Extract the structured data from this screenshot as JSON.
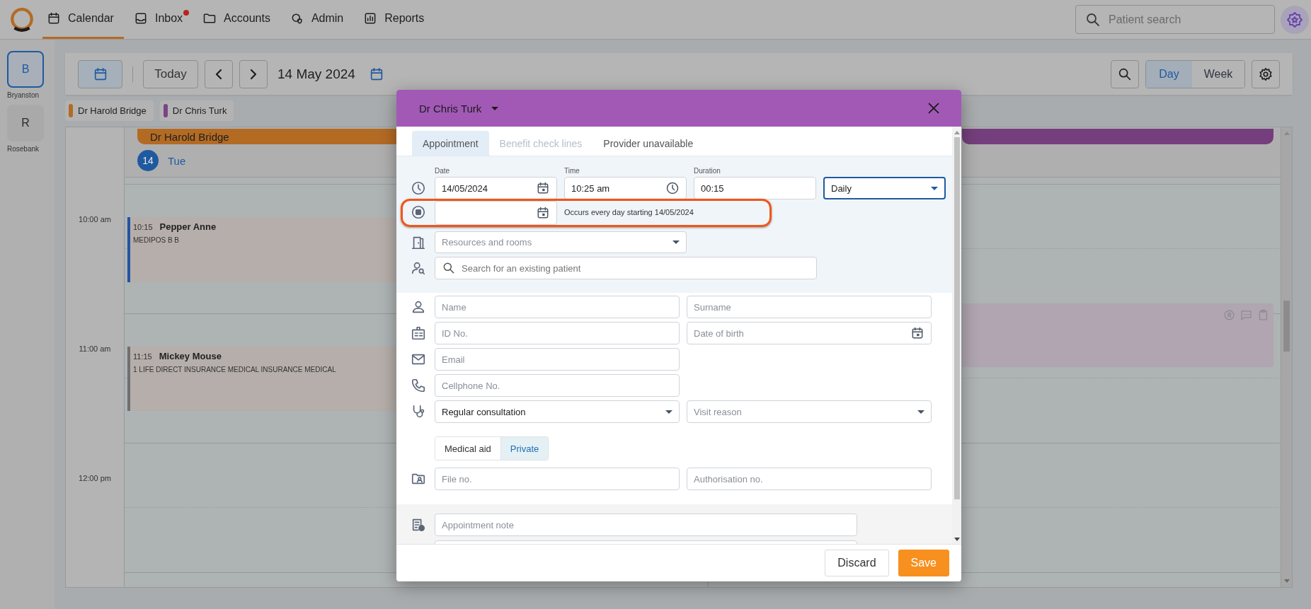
{
  "nav": {
    "items": [
      {
        "label": "Calendar",
        "selected": true,
        "unread": false
      },
      {
        "label": "Inbox",
        "selected": false,
        "unread": true
      },
      {
        "label": "Accounts",
        "selected": false,
        "unread": false
      },
      {
        "label": "Admin",
        "selected": false,
        "unread": false
      },
      {
        "label": "Reports",
        "selected": false,
        "unread": false
      }
    ],
    "search": {
      "placeholder": "Patient search"
    }
  },
  "locations": [
    {
      "initial": "B",
      "label": "Bryanston",
      "selected": true
    },
    {
      "initial": "R",
      "label": "Rosebank",
      "selected": false
    }
  ],
  "toolbar": {
    "today": "Today",
    "date": "14 May 2024",
    "views": [
      {
        "label": "Day",
        "selected": true
      },
      {
        "label": "Week",
        "selected": false
      }
    ]
  },
  "providers": [
    {
      "name": "Dr Harold Bridge",
      "color": "#b36b24"
    },
    {
      "name": "Dr Chris Turk",
      "color": "#7a4585"
    }
  ],
  "calendar": {
    "times": [
      "10:00 am",
      "11:00 am",
      "12:00 pm"
    ],
    "columns": [
      {
        "provider": "Dr Harold Bridge",
        "color": "#b36b24",
        "day_number": "14",
        "day_name": "Tue",
        "appointments": [
          {
            "time": "10:15",
            "patient": "Pepper Anne",
            "detail": "MEDIPOS B B",
            "color": "#2453a0"
          },
          {
            "time": "11:15",
            "patient": "Mickey Mouse",
            "detail": "1 LIFE DIRECT INSURANCE MEDICAL INSURANCE MEDICAL",
            "color": "#6f6f6f"
          }
        ]
      },
      {
        "color": "#743f7c",
        "appointments": [
          {
            "color": "#b0a5b0"
          }
        ]
      }
    ]
  },
  "modal": {
    "provider": "Dr Chris Turk",
    "tabs": [
      {
        "label": "Appointment",
        "selected": true,
        "disabled": false
      },
      {
        "label": "Benefit check lines",
        "selected": false,
        "disabled": true
      },
      {
        "label": "Provider unavailable",
        "selected": false,
        "disabled": false
      }
    ],
    "schedule": [
      {
        "kind": "date",
        "label": "Date",
        "value": "14/05/2024"
      },
      {
        "kind": "time",
        "label": "Time",
        "value": "10:25 am"
      },
      {
        "kind": "text",
        "label": "Duration",
        "value": "00:15"
      },
      {
        "kind": "select",
        "value": "Daily",
        "focused": true
      }
    ],
    "recurrence": {
      "summary": "Occurs every day starting 14/05/2024",
      "highlighted": true
    },
    "resources": {
      "placeholder": "Resources and rooms"
    },
    "patient_search": {
      "placeholder": "Search for an existing patient"
    },
    "patient_rows": [
      {
        "kind": "fields",
        "fields": [
          {
            "kind": "text",
            "placeholder": "Name"
          },
          {
            "kind": "text",
            "placeholder": "Surname"
          }
        ]
      },
      {
        "kind": "fields",
        "fields": [
          {
            "kind": "text",
            "placeholder": "ID No."
          },
          {
            "kind": "date",
            "placeholder": "Date of birth"
          }
        ]
      },
      {
        "kind": "fields",
        "fields": [
          {
            "kind": "text",
            "placeholder": "Email"
          }
        ]
      },
      {
        "kind": "fields",
        "fields": [
          {
            "kind": "text",
            "placeholder": "Cellphone No."
          }
        ]
      },
      {
        "kind": "fields",
        "fields": [
          {
            "kind": "select",
            "value": "Regular consultation"
          },
          {
            "kind": "select",
            "placeholder": "Visit reason"
          }
        ]
      },
      {
        "kind": "segmented",
        "options": [
          {
            "label": "Medical aid",
            "selected": false
          },
          {
            "label": "Private",
            "selected": true
          }
        ]
      },
      {
        "kind": "fields",
        "fields": [
          {
            "kind": "text",
            "placeholder": "File no."
          },
          {
            "kind": "text",
            "placeholder": "Authorisation no."
          }
        ]
      }
    ],
    "notes": [
      {
        "placeholder": "Appointment note"
      }
    ],
    "buttons": [
      {
        "label": "Discard",
        "kind": "secondary"
      },
      {
        "label": "Save",
        "kind": "primary"
      }
    ]
  }
}
